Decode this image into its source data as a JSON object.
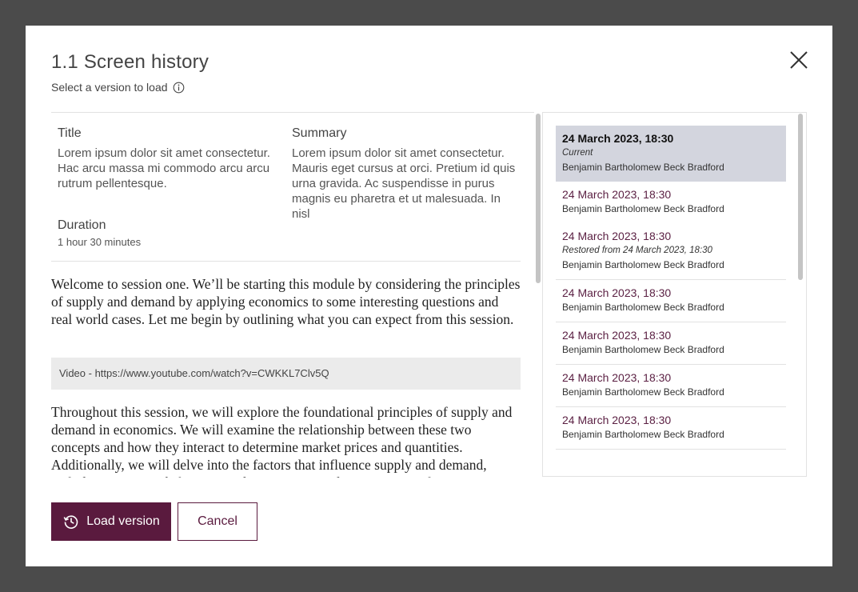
{
  "dialog": {
    "title": "1.1 Screen history",
    "subtitle": "Select a version to load"
  },
  "preview": {
    "title_label": "Title",
    "title_text": "Lorem ipsum dolor sit amet consectetur. Hac arcu massa mi commodo arcu arcu rutrum pellentesque.",
    "summary_label": "Summary",
    "summary_text": "Lorem ipsum dolor sit amet consectetur. Mauris eget cursus at orci. Pretium id quis urna gravida. Ac suspendisse in purus magnis eu pharetra et ut malesuada. In nisl",
    "duration_label": "Duration",
    "duration_value": "1 hour  30 minutes",
    "paragraph1": "Welcome to session one. We’ll be starting this module by considering the principles of supply and demand by applying economics to some interesting questions and real world cases. Let me begin by outlining what you can expect from this session.",
    "video": "Video - https://www.youtube.com/watch?v=CWKKL7Clv5Q",
    "paragraph2": "Throughout this session, we will explore the foundational principles of supply and demand in economics. We will examine the relationship between these two concepts and how they interact to determine market prices and quantities. Additionally, we will delve into the factors that influence supply and demand, including consumer behavior, production costs, and government policies."
  },
  "versions": [
    {
      "date": "24 March 2023, 18:30",
      "note": "Current",
      "author": "Benjamin Bartholomew Beck Bradford"
    },
    {
      "date": "24 March 2023, 18:30",
      "note": "",
      "author": "Benjamin Bartholomew Beck Bradford"
    },
    {
      "date": "24 March 2023, 18:30",
      "note": "Restored from 24 March 2023, 18:30",
      "author": "Benjamin Bartholomew Beck Bradford"
    },
    {
      "date": "24 March 2023, 18:30",
      "note": "",
      "author": "Benjamin Bartholomew Beck Bradford"
    },
    {
      "date": "24 March 2023, 18:30",
      "note": "",
      "author": "Benjamin Bartholomew Beck Bradford"
    },
    {
      "date": "24 March 2023, 18:30",
      "note": "",
      "author": "Benjamin Bartholomew Beck Bradford"
    },
    {
      "date": "24 March 2023, 18:30",
      "note": "",
      "author": "Benjamin Bartholomew Beck Bradford"
    }
  ],
  "footer": {
    "load_label": "Load version",
    "cancel_label": "Cancel"
  },
  "colors": {
    "accent": "#5a1a3e",
    "selected_row": "#d3d5de",
    "overlay": "#4b4b4b"
  },
  "icons": {
    "close": "close-icon",
    "info": "info-icon",
    "history": "history-icon"
  }
}
